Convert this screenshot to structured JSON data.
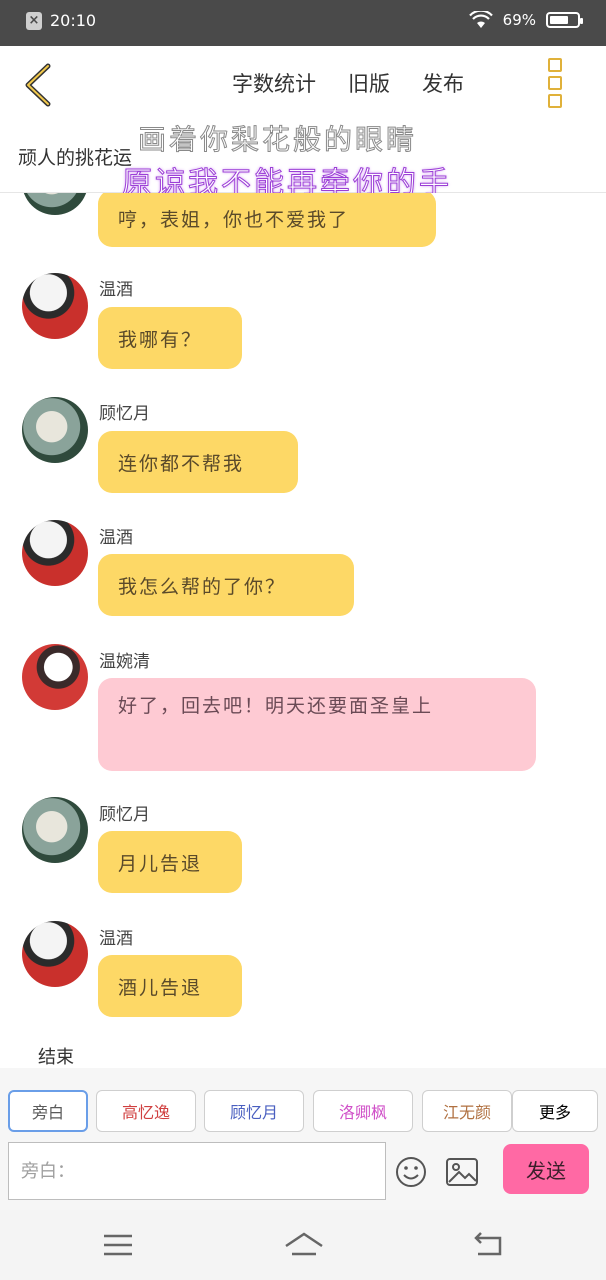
{
  "status_bar": {
    "time": "20:10",
    "battery": "69%",
    "battery_level": 0.69
  },
  "header": {
    "nav": [
      "字数统计",
      "旧版",
      "发布"
    ],
    "title": "顽人的挑花运",
    "lyric_line1": "画着你梨花般的眼睛",
    "lyric_line2": "原谅我不能再牵你的手"
  },
  "messages": [
    {
      "sender": "",
      "text": "哼，表姐，你也不爱我了",
      "avatar": "green",
      "color": "yellow"
    },
    {
      "sender": "温酒",
      "text": "我哪有？",
      "avatar": "red",
      "color": "yellow"
    },
    {
      "sender": "顾忆月",
      "text": "连你都不帮我",
      "avatar": "green",
      "color": "yellow"
    },
    {
      "sender": "温酒",
      "text": "我怎么帮的了你？",
      "avatar": "red",
      "color": "yellow"
    },
    {
      "sender": "温婉清",
      "text": "好了，回去吧！明天还要面圣皇上",
      "avatar": "lady",
      "color": "pink"
    },
    {
      "sender": "顾忆月",
      "text": "月儿告退",
      "avatar": "green",
      "color": "yellow"
    },
    {
      "sender": "温酒",
      "text": "酒儿告退",
      "avatar": "red",
      "color": "yellow"
    }
  ],
  "end_text": "结束",
  "roles": [
    {
      "label": "旁白",
      "color": "#5a5a5a"
    },
    {
      "label": "高忆逸",
      "color": "#d04040"
    },
    {
      "label": "顾忆月",
      "color": "#4a5fc0"
    },
    {
      "label": "洛卿枫",
      "color": "#d050c8"
    },
    {
      "label": "江无颜",
      "color": "#b07040"
    }
  ],
  "more_label": "更多",
  "input": {
    "placeholder": "旁白："
  },
  "send_label": "发送"
}
